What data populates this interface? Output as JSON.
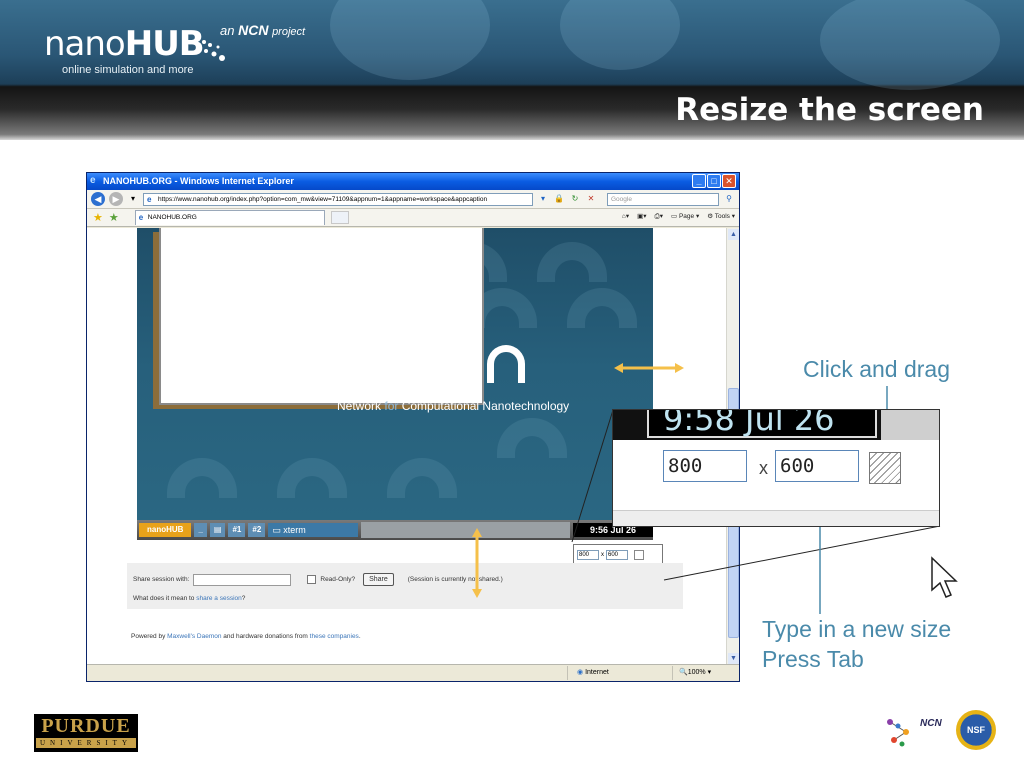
{
  "slide": {
    "title": "Resize the screen",
    "brand": {
      "logo_light": "nano",
      "logo_bold": "HUB",
      "tagline": "online simulation and more",
      "ncn_prefix": "an",
      "ncn_name": "NCN",
      "ncn_suffix": "project"
    }
  },
  "browser": {
    "window_title": "NANOHUB.ORG - Windows Internet Explorer",
    "url": "https://www.nanohub.org/index.php?option=com_mw&view=71109&appnum=1&appname=workspace&appcaption",
    "search_placeholder": "Google",
    "tab_label": "NANOHUB.ORG",
    "cmd_page": "Page",
    "cmd_tools": "Tools",
    "status_zone": "Internet",
    "status_zoom": "100%"
  },
  "workspace": {
    "ncn_text_bold": "Network",
    "ncn_text_dim": "for",
    "ncn_text_rest": "Computational Nanotechnology",
    "taskbar": {
      "logo": "nanoHUB",
      "btn_min": "_",
      "btn_1": "#1",
      "btn_2": "#2",
      "xterm": "xterm",
      "clock": "9:56 Jul 26"
    },
    "size_width": "800",
    "size_x": "x",
    "size_height": "600"
  },
  "share": {
    "label": "Share session with:",
    "readonly_label": "Read-Only?",
    "button": "Share",
    "status": "(Session is currently not shared.)",
    "question": "What does it mean to",
    "question_link": "share a session",
    "question_end": "?"
  },
  "footer_note": {
    "prefix": "Powered by",
    "link1": "Maxwell's Daemon",
    "middle": "and hardware donations from",
    "link2": "these companies",
    "end": "."
  },
  "zoom_callout": {
    "clock": "9:58 Jul 26",
    "width": "800",
    "x": "x",
    "height": "600"
  },
  "callouts": {
    "drag": "Click and drag",
    "type_line1": "Type in a new size",
    "type_line2": "Press Tab"
  },
  "logos": {
    "purdue_top": "PURDUE",
    "purdue_bottom": "UNIVERSITY",
    "ncn": "NCN",
    "nsf": "NSF"
  },
  "colors": {
    "callout_text": "#4a8aaa",
    "arrow": "#f5c04a",
    "title_text": "#ffffff"
  }
}
